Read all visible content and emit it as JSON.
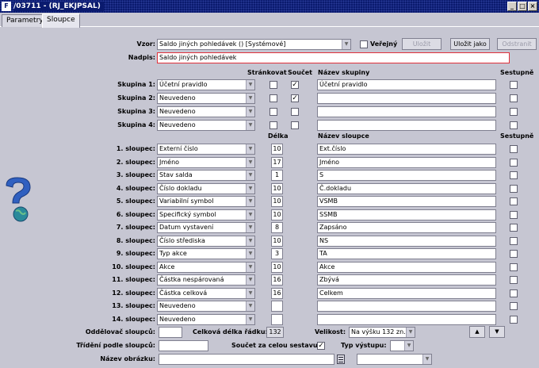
{
  "window": {
    "logo": "F",
    "title": "/03711 - (RJ_EKJPSAL)",
    "minimize": "_",
    "maximize": "□",
    "close": "×"
  },
  "tabs": [
    {
      "label": "Parametry"
    },
    {
      "label": "Sloupce"
    }
  ],
  "form": {
    "vzor_label": "Vzor:",
    "vzor_value": "Saldo jiných pohledávek  ()  [Systémové]",
    "verejny_label": "Veřejný",
    "btn_ulozit": "Uložit",
    "btn_ulozit_jako": "Uložit jako",
    "btn_odstranit": "Odstranit",
    "nadpis_label": "Nadpis:",
    "nadpis_value": "Saldo jiných pohledávek"
  },
  "group_headers": {
    "strankovat": "Stránkovat",
    "soucet": "Součet",
    "nazev_skupiny": "Název skupiny",
    "sestupne": "Sestupně"
  },
  "groups": [
    {
      "label": "Skupina 1:",
      "value": "Účetní pravidlo",
      "strankovat": false,
      "soucet": true,
      "nazev": "Účetní pravidlo",
      "sestupne": false
    },
    {
      "label": "Skupina 2:",
      "value": "Neuvedeno",
      "strankovat": false,
      "soucet": true,
      "nazev": "",
      "sestupne": false
    },
    {
      "label": "Skupina 3:",
      "value": "Neuvedeno",
      "strankovat": false,
      "soucet": false,
      "nazev": "",
      "sestupne": false
    },
    {
      "label": "Skupina 4:",
      "value": "Neuvedeno",
      "strankovat": false,
      "soucet": false,
      "nazev": "",
      "sestupne": false
    }
  ],
  "column_headers": {
    "delka": "Délka",
    "nazev_sloupce": "Název sloupce",
    "sestupne": "Sestupně"
  },
  "columns": [
    {
      "label": "1. sloupec:",
      "value": "Externí číslo",
      "delka": "10",
      "nazev": "Ext.číslo"
    },
    {
      "label": "2. sloupec:",
      "value": "Jméno",
      "delka": "17",
      "nazev": "Jméno"
    },
    {
      "label": "3. sloupec:",
      "value": "Stav salda",
      "delka": "1",
      "nazev": "S"
    },
    {
      "label": "4. sloupec:",
      "value": "Číslo dokladu",
      "delka": "10",
      "nazev": "Č.dokladu"
    },
    {
      "label": "5. sloupec:",
      "value": "Variabilní symbol",
      "delka": "10",
      "nazev": "VSMB"
    },
    {
      "label": "6. sloupec:",
      "value": "Specifický symbol",
      "delka": "10",
      "nazev": "SSMB"
    },
    {
      "label": "7. sloupec:",
      "value": "Datum vystavení",
      "delka": "8",
      "nazev": "Zapsáno"
    },
    {
      "label": "8. sloupec:",
      "value": "Číslo střediska",
      "delka": "10",
      "nazev": "NS"
    },
    {
      "label": "9. sloupec:",
      "value": "Typ akce",
      "delka": "3",
      "nazev": "TA"
    },
    {
      "label": "10. sloupec:",
      "value": "Akce",
      "delka": "10",
      "nazev": "Akce"
    },
    {
      "label": "11. sloupec:",
      "value": "Částka nespárovaná",
      "delka": "16",
      "nazev": "Zbývá"
    },
    {
      "label": "12. sloupec:",
      "value": "Částka celková",
      "delka": "16",
      "nazev": "Celkem"
    },
    {
      "label": "13. sloupec:",
      "value": "Neuvedeno",
      "delka": "",
      "nazev": ""
    },
    {
      "label": "14. sloupec:",
      "value": "Neuvedeno",
      "delka": "",
      "nazev": ""
    }
  ],
  "footer": {
    "oddelovac_label": "Oddělovač sloupců:",
    "oddelovac_value": "",
    "celkova_delka_label": "Celková délka řádku:",
    "celkova_delka_value": "132",
    "velikost_label": "Velikost:",
    "velikost_value": "Na výšku 132 zn.",
    "trideni_label": "Třídění podle sloupců:",
    "trideni_value": "",
    "soucet_label": "Součet za celou sestavu:",
    "soucet_checked": true,
    "typ_vystupu_label": "Typ výstupu:",
    "typ_vystupu_value": "",
    "nazev_obrazku_label": "Název obrázku:",
    "nazev_obrazku_value": "",
    "extra_select_value": "",
    "up_arrow": "▲",
    "down_arrow": "▼"
  },
  "colors": {
    "title_bar": "#0a1a6e",
    "background": "#c6c6d2",
    "nadpis_border": "#e0303a",
    "help_icon": "#3060c0"
  }
}
